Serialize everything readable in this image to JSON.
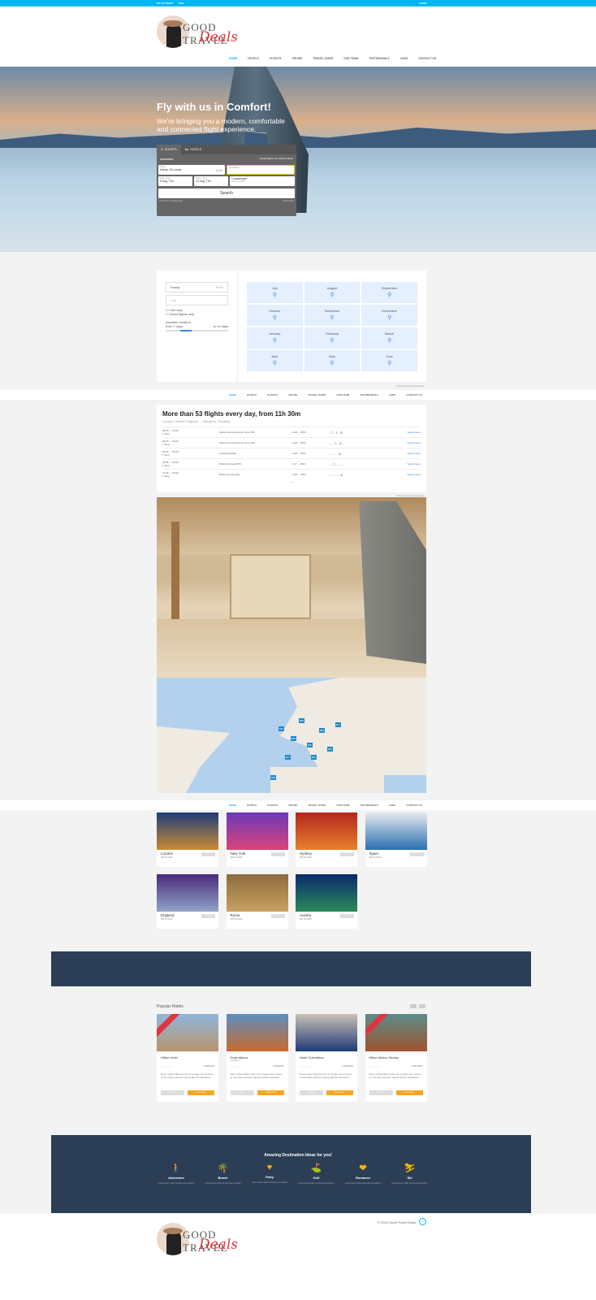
{
  "topbar": {
    "account": "MY ACCOUNT",
    "currency": "USD",
    "login": "LOGIN"
  },
  "brand": {
    "line1": "GOOD TRAVEL",
    "line2": "Deals"
  },
  "nav": [
    "HOME",
    "HOTELS",
    "FLIGHTS",
    "CRUISE",
    "TRAVEL GUIDE",
    "OUR TEAM",
    "TESTIMONIALS",
    "CARS",
    "CONTACT US"
  ],
  "hero": {
    "title": "Fly with us in Comfort!",
    "subtitle": "We're bringing you a modern, comfortable and connected flight experience."
  },
  "search_widget": {
    "tabs": [
      "FLIGHTS",
      "HOTELS"
    ],
    "provider": "aviasales",
    "tagline": "Cheap flights and airline tickets",
    "origin_label": "Origin",
    "origin_value": "Kandy, Sri Lanka",
    "origin_code": "KDW",
    "destination_label": "Destination",
    "depart_label": "Depart date",
    "depart_value": "5 Aug, Thu",
    "return_label": "Return date",
    "return_value": "12 Aug, Thu",
    "passengers": "1 passenger",
    "class": "economy class",
    "search": "Search",
    "powered": "Powered by",
    "partner": "travelpayouts",
    "show_hotels": "Show hotels"
  },
  "calendar": {
    "origin": "Kandy",
    "origin_code": "KDW",
    "city_placeholder": "City",
    "one_way": "One way",
    "direct": "Direct flights only",
    "duration_label": "Vacation duration",
    "from": "from 7 days",
    "to": "to 14 days",
    "months": [
      "July",
      "August",
      "September",
      "October",
      "November",
      "December",
      "January",
      "February",
      "March",
      "April",
      "May",
      "June"
    ],
    "powered": "Powered by travelpayouts"
  },
  "flights": {
    "title": "More than 53 flights every day, from 11h 30m",
    "route": "London, United Kingdom → Bangkok, Thailand",
    "rows": [
      {
        "time": "06:00 → 04:50",
        "stops": "1 Stop",
        "airline": "Swiss International Air Lines 395",
        "airports": "LHR → BKK",
        "prices": "- T - T - $ -",
        "action": "Select dates"
      },
      {
        "time": "06:00 → 05:20",
        "stops": "1 Stop",
        "airline": "Swiss International Air Lines 395",
        "airports": "LHR → BKK",
        "prices": "- - - T - $ -",
        "action": "Select dates"
      },
      {
        "time": "06:45 → 05:20",
        "stops": "1 Stop",
        "airline": "Lufthansa 9039",
        "airports": "LHR → BKK",
        "prices": "- - - - - $ -",
        "action": "Select dates"
      },
      {
        "time": "06:55 → 04:50",
        "stops": "1 Stop",
        "airline": "British Airways 8755",
        "airports": "LCY → BKK",
        "prices": "- - T - - - - -",
        "action": "Select dates"
      },
      {
        "time": "07:00 → 06:00",
        "stops": "1 Stop",
        "airline": "British Airways 812",
        "airports": "LHR → BKK",
        "prices": "- - - - - - $",
        "action": "Select dates"
      }
    ],
    "powered": "Powered by travelpayouts"
  },
  "map_prices": [
    "$45",
    "$63",
    "$89",
    "$55",
    "$71",
    "$42",
    "$98",
    "$60",
    "$38",
    "$77"
  ],
  "destinations": [
    {
      "name": "London",
      "sub": "995 PLACES",
      "btn": "VIEW ALL",
      "c1": "#1f3d78",
      "c2": "#c98a36"
    },
    {
      "name": "New York",
      "sub": "995 PLACES",
      "btn": "VIEW ALL",
      "c1": "#6b38b8",
      "c2": "#d9457a"
    },
    {
      "name": "Sydney",
      "sub": "995 PLACES",
      "btn": "VIEW ALL",
      "c1": "#b3261e",
      "c2": "#e8812c"
    },
    {
      "name": "Spain",
      "sub": "995 PLACES",
      "btn": "VIEW ALL",
      "c1": "#e6e9ef",
      "c2": "#2c6fb0"
    },
    {
      "name": "England",
      "sub": "995 PLACES",
      "btn": "VIEW ALL",
      "c1": "#4a2a7a",
      "c2": "#8fa4c8"
    },
    {
      "name": "Rome",
      "sub": "995 PLACES",
      "btn": "VIEW ALL",
      "c1": "#8c6b3f",
      "c2": "#c9a060"
    },
    {
      "name": "Austria",
      "sub": "995 PLACES",
      "btn": "VIEW ALL",
      "c1": "#0b2a6a",
      "c2": "#2a8a5a"
    }
  ],
  "hotels": {
    "title": "Popular Hotels",
    "items": [
      {
        "name": "Hilton Hotel",
        "loc": "",
        "reviews": "2 REVIEWS",
        "desc": "Nunc cursus libero purus ac congue arcu cursus ut sed vitae pulvinar massa idporta nequetiam.",
        "btn1": "DETAILS",
        "btn2": "BOOK NOW",
        "c1": "#8fb6de",
        "c2": "#b8956a",
        "ribbon": true
      },
      {
        "name": "Hotel Alpina",
        "loc": "CANNES",
        "reviews": "2 REVIEWS",
        "desc": "Nunc cursus libero purus ac congue arcu cursus ut sed vitae pulvinar massa idporta nequetiam.",
        "btn1": "DETAILS",
        "btn2": "BOOK NOW",
        "c1": "#5b8fc0",
        "c2": "#c9692e",
        "ribbon": false
      },
      {
        "name": "Hotel Colombina",
        "loc": "",
        "reviews": "2 REVIEWS",
        "desc": "Nunc cursus libero purus ac congue arcu cursus ut sed vitae pulvinar massa idporta nequetiam.",
        "btn1": "DETAILS",
        "btn2": "BOOK NOW",
        "c1": "#c9c1b4",
        "c2": "#1f3a78",
        "ribbon": false
      },
      {
        "name": "Hilton Molino Stucky",
        "loc": "",
        "reviews": "2 REVIEWS",
        "desc": "Nunc cursus libero purus ac congue arcu cursus ut sed vitae pulvinar massa idporta nequetiam.",
        "btn1": "DETAILS",
        "btn2": "BOOK NOW",
        "c1": "#5a8d8a",
        "c2": "#a0522d",
        "ribbon": true
      }
    ]
  },
  "ideas": {
    "title": "Amazing Destination Ideas for you!",
    "items": [
      {
        "label": "Adventure",
        "icon": "🚶",
        "desc": "Lorem ipsum dolor sit amet text industry"
      },
      {
        "label": "Beach",
        "icon": "🌴",
        "desc": "Lorem ipsum dolor sit amet text industry"
      },
      {
        "label": "Party",
        "icon": "♥",
        "desc": "Lorem ipsum dolor sit amet text industry"
      },
      {
        "label": "Golf",
        "icon": "⛳",
        "desc": "Lorem ipsum dolor sit amet text industry"
      },
      {
        "label": "Romance",
        "icon": "❤",
        "desc": "Lorem ipsum dolor sit amet text industry"
      },
      {
        "label": "Ski",
        "icon": "⛷",
        "desc": "Lorem ipsum dolor sit amet text industry"
      }
    ]
  },
  "footer": {
    "copyright": "© 2020 Good Travel Deals"
  }
}
